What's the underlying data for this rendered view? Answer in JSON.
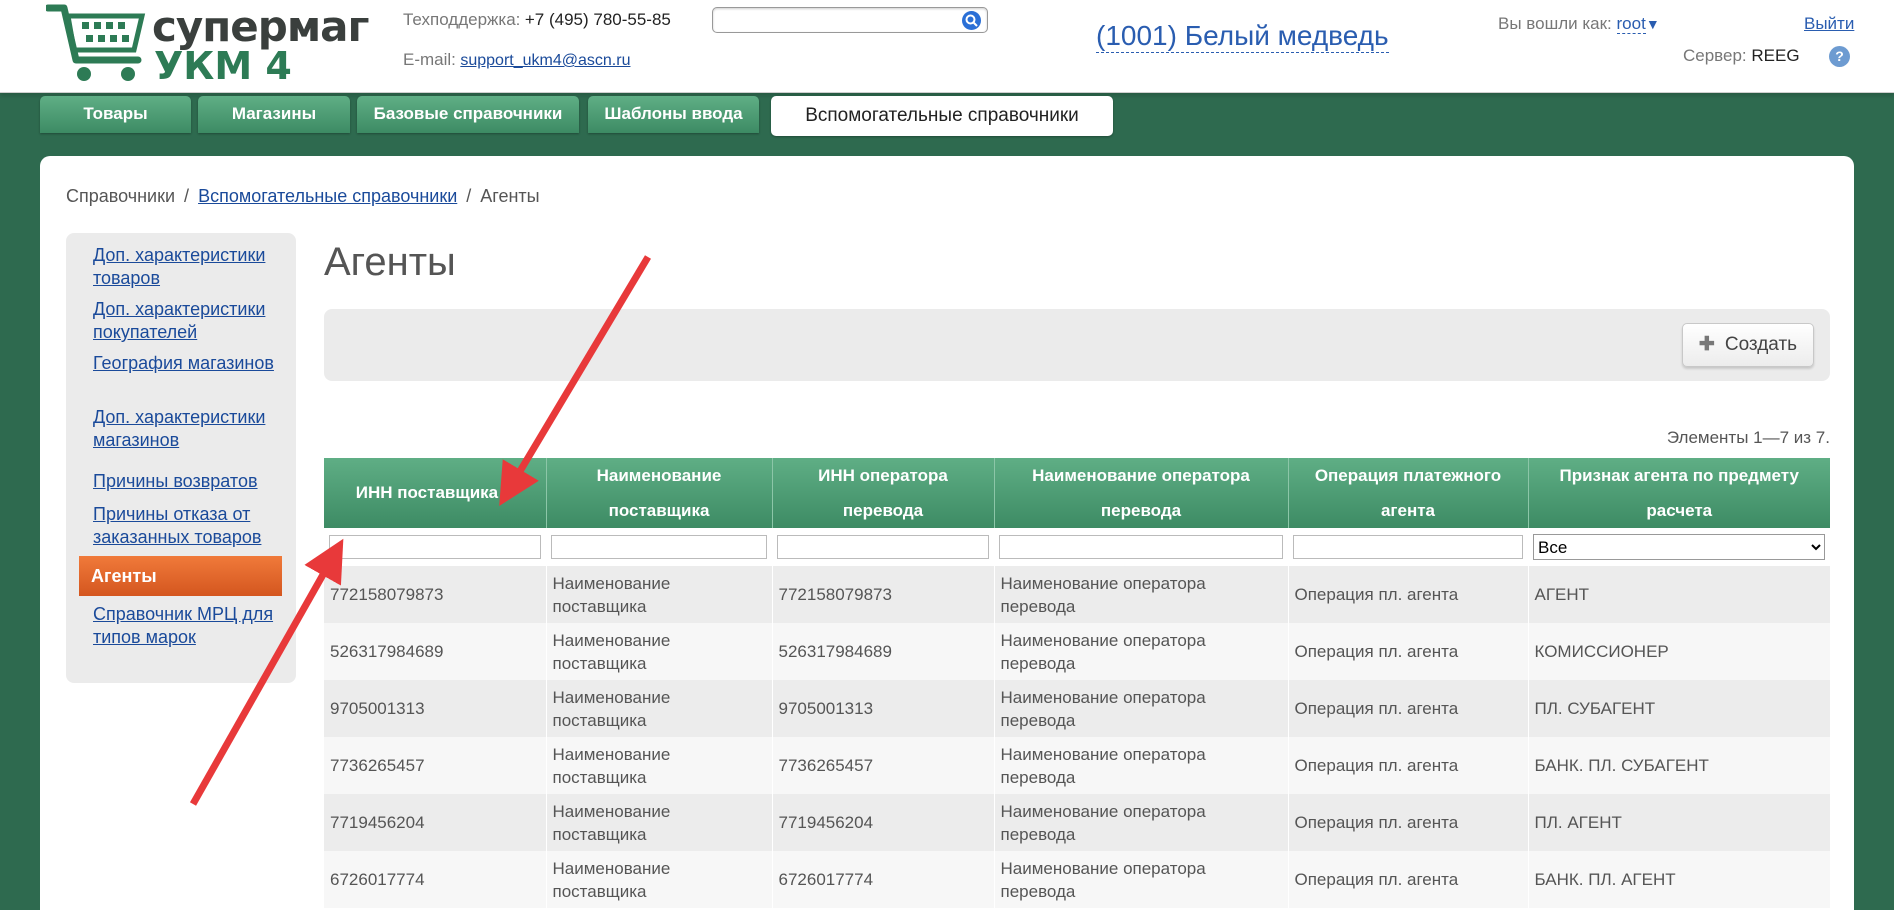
{
  "header": {
    "brand_line1": "супермаг",
    "brand_line2": "УКМ 4",
    "support_phone_label": "Техподдержка:",
    "support_phone": "+7 (495) 780-55-85",
    "support_email_label": "E-mail:",
    "support_email": "support_ukm4@ascn.ru",
    "search_placeholder": "",
    "store_name": "(1001) Белый медведь",
    "logged_in_label": "Вы вошли как:",
    "user_name": "root",
    "logout_label": "Выйти",
    "server_label": "Сервер:",
    "server_name": "REEG",
    "help_label": "?"
  },
  "nav": {
    "tabs": [
      {
        "label": "Товары"
      },
      {
        "label": "Магазины"
      },
      {
        "label": "Базовые справочники"
      },
      {
        "label": "Шаблоны ввода"
      },
      {
        "label": "Вспомогательные справочники"
      }
    ]
  },
  "breadcrumb": {
    "root": "Справочники",
    "section": "Вспомогательные справочники",
    "current": "Агенты",
    "separator": "/"
  },
  "sidebar": {
    "items": [
      {
        "label": "Доп. характеристики товаров"
      },
      {
        "label": "Доп. характеристики покупателей"
      },
      {
        "label": "География магазинов"
      },
      {
        "label": "Доп. характеристики магазинов"
      },
      {
        "label": "Причины возвратов"
      },
      {
        "label": "Причины отказа от заказанных товаров"
      },
      {
        "label": "Агенты"
      },
      {
        "label": "Справочник МРЦ для типов марок"
      }
    ]
  },
  "main": {
    "title": "Агенты",
    "create_label": "Создать",
    "counter": "Элементы 1—7 из 7."
  },
  "table": {
    "columns": [
      "ИНН поставщика",
      "Наименование поставщика",
      "ИНН оператора перевода",
      "Наименование оператора перевода",
      "Операция платежного агента",
      "Признак агента по предмету расчета"
    ],
    "sort_indicator": "▼",
    "filter_select_value": "Все",
    "rows": [
      [
        "772158079873",
        "Наименование поставщика",
        "772158079873",
        "Наименование оператора перевода",
        "Операция пл. агента",
        "АГЕНТ"
      ],
      [
        "526317984689",
        "Наименование поставщика",
        "526317984689",
        "Наименование оператора перевода",
        "Операция пл. агента",
        "КОМИССИОНЕР"
      ],
      [
        "9705001313",
        "Наименование поставщика",
        "9705001313",
        "Наименование оператора перевода",
        "Операция пл. агента",
        "ПЛ. СУБАГЕНТ"
      ],
      [
        "7736265457",
        "Наименование поставщика",
        "7736265457",
        "Наименование оператора перевода",
        "Операция пл. агента",
        "БАНК. ПЛ. СУБАГЕНТ"
      ],
      [
        "7719456204",
        "Наименование поставщика",
        "7719456204",
        "Наименование оператора перевода",
        "Операция пл. агента",
        "ПЛ. АГЕНТ"
      ],
      [
        "6726017774",
        "Наименование поставщика",
        "6726017774",
        "Наименование оператора перевода",
        "Операция пл. агента",
        "БАНК. ПЛ. АГЕНТ"
      ]
    ]
  },
  "colors": {
    "accent_green": "#3d8b64",
    "active_orange": "#d4561f",
    "link_blue": "#1a4a9a",
    "annotation_red": "#e8393a"
  }
}
